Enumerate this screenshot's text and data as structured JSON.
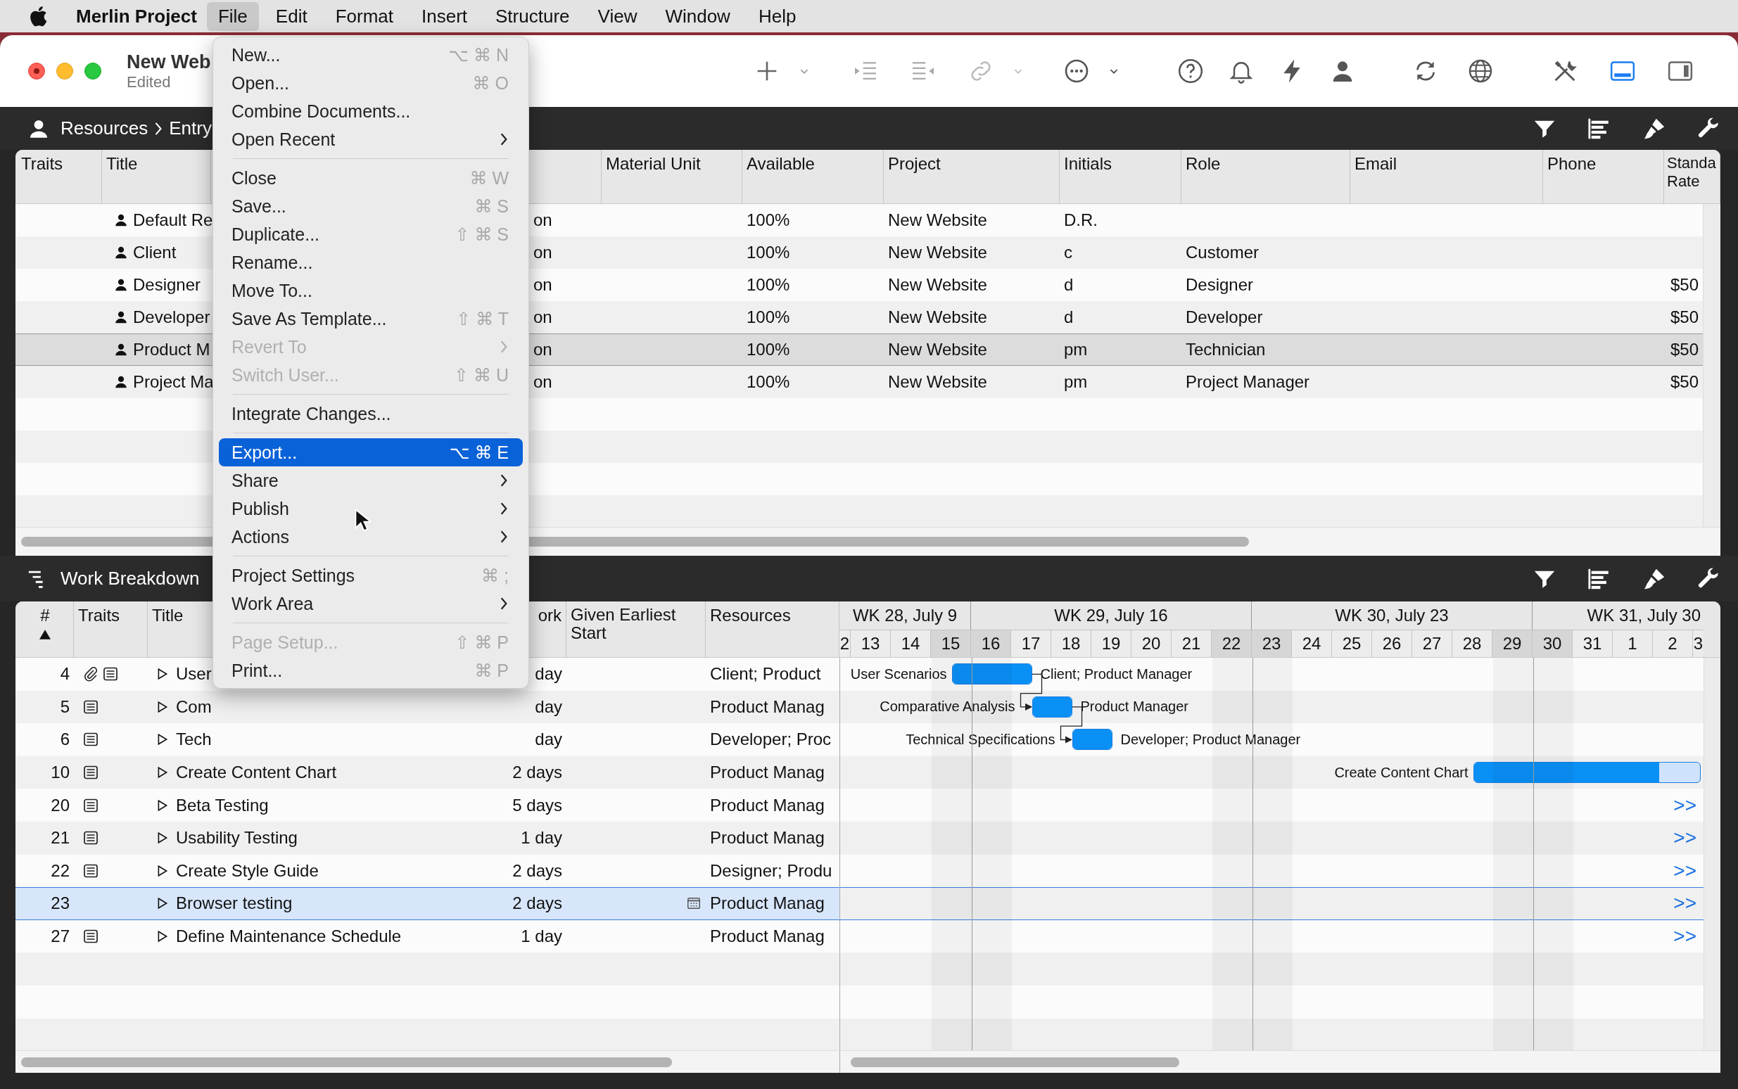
{
  "menu_bar": {
    "app_name": "Merlin Project",
    "menus": [
      {
        "label": "File",
        "selected": true
      },
      {
        "label": "Edit",
        "selected": false
      },
      {
        "label": "Format",
        "selected": false
      },
      {
        "label": "Insert",
        "selected": false
      },
      {
        "label": "Structure",
        "selected": false
      },
      {
        "label": "View",
        "selected": false
      },
      {
        "label": "Window",
        "selected": false
      },
      {
        "label": "Help",
        "selected": false
      }
    ]
  },
  "window": {
    "title": "New Web",
    "subtitle": "Edited"
  },
  "toolbar": {
    "layout_buttons": [
      {
        "selected": true
      },
      {
        "selected": false
      }
    ]
  },
  "resources_view": {
    "breadcrumb": [
      "Resources",
      "Entry"
    ],
    "headers": {
      "traits": "Traits",
      "title": "Title",
      "material_unit": "Material Unit",
      "available": "Available",
      "project": "Project",
      "initials": "Initials",
      "role": "Role",
      "email": "Email",
      "phone": "Phone",
      "standard_rate": "Standa Rate"
    },
    "rows": [
      {
        "title": "Default Re",
        "column_3": "on",
        "available": "100%",
        "project": "New Website",
        "initials": "D.R.",
        "selected": false
      },
      {
        "title": "Client",
        "column_3": "on",
        "available": "100%",
        "project": "New Website",
        "initials": "c",
        "role": "Customer",
        "selected": false
      },
      {
        "title": "Designer",
        "column_3": "on",
        "available": "100%",
        "project": "New Website",
        "initials": "d",
        "role": "Designer",
        "standard_rate": "$50",
        "selected": false
      },
      {
        "title": "Developer",
        "column_3": "on",
        "available": "100%",
        "project": "New Website",
        "initials": "d",
        "role": "Developer",
        "standard_rate": "$50",
        "selected": false
      },
      {
        "title": "Product M",
        "column_3": "on",
        "available": "100%",
        "project": "New Website",
        "initials": "pm",
        "role": "Technician",
        "standard_rate": "$50",
        "selected": true
      },
      {
        "title": "Project Ma",
        "column_3": "on",
        "available": "100%",
        "project": "New Website",
        "initials": "pm",
        "role": "Project Manager",
        "standard_rate": "$50",
        "selected": false
      }
    ]
  },
  "file_menu": {
    "items": [
      {
        "kind": "item",
        "label": "New...",
        "shortcut": "⌥ ⌘ N",
        "submenu": false,
        "disabled": false,
        "selected": false
      },
      {
        "kind": "item",
        "label": "Open...",
        "shortcut": "⌘ O",
        "submenu": false,
        "disabled": false,
        "selected": false
      },
      {
        "kind": "item",
        "label": "Combine Documents...",
        "submenu": false,
        "disabled": false,
        "selected": false
      },
      {
        "kind": "item",
        "label": "Open Recent",
        "submenu": true,
        "disabled": false,
        "selected": false
      },
      {
        "kind": "separator"
      },
      {
        "kind": "item",
        "label": "Close",
        "shortcut": "⌘ W",
        "submenu": false,
        "disabled": false,
        "selected": false
      },
      {
        "kind": "item",
        "label": "Save...",
        "shortcut": "⌘ S",
        "submenu": false,
        "disabled": false,
        "selected": false
      },
      {
        "kind": "item",
        "label": "Duplicate...",
        "shortcut": "⇧ ⌘ S",
        "submenu": false,
        "disabled": false,
        "selected": false
      },
      {
        "kind": "item",
        "label": "Rename...",
        "submenu": false,
        "disabled": false,
        "selected": false
      },
      {
        "kind": "item",
        "label": "Move To...",
        "submenu": false,
        "disabled": false,
        "selected": false
      },
      {
        "kind": "item",
        "label": "Save As Template...",
        "shortcut": "⇧ ⌘ T",
        "submenu": false,
        "disabled": false,
        "selected": false
      },
      {
        "kind": "item",
        "label": "Revert To",
        "submenu": true,
        "disabled": true,
        "selected": false
      },
      {
        "kind": "item",
        "label": "Switch User...",
        "shortcut": "⇧ ⌘ U",
        "submenu": false,
        "disabled": true,
        "selected": false
      },
      {
        "kind": "separator"
      },
      {
        "kind": "item",
        "label": "Integrate Changes...",
        "submenu": false,
        "disabled": false,
        "selected": false
      },
      {
        "kind": "separator"
      },
      {
        "kind": "item",
        "label": "Export...",
        "shortcut": "⌥ ⌘ E",
        "submenu": false,
        "disabled": false,
        "selected": true
      },
      {
        "kind": "item",
        "label": "Share",
        "submenu": true,
        "disabled": false,
        "selected": false
      },
      {
        "kind": "item",
        "label": "Publish",
        "submenu": true,
        "disabled": false,
        "selected": false
      },
      {
        "kind": "item",
        "label": "Actions",
        "submenu": true,
        "disabled": false,
        "selected": false
      },
      {
        "kind": "separator"
      },
      {
        "kind": "item",
        "label": "Project Settings",
        "shortcut": "⌘ ;",
        "submenu": false,
        "disabled": false,
        "selected": false
      },
      {
        "kind": "item",
        "label": "Work Area",
        "submenu": true,
        "disabled": false,
        "selected": false
      },
      {
        "kind": "separator"
      },
      {
        "kind": "item",
        "label": "Page Setup...",
        "shortcut": "⇧ ⌘ P",
        "submenu": false,
        "disabled": true,
        "selected": false
      },
      {
        "kind": "item",
        "label": "Print...",
        "shortcut": "⌘ P",
        "submenu": false,
        "disabled": false,
        "selected": false
      }
    ]
  },
  "work_view": {
    "title": "Work Breakdown",
    "headers": {
      "number": "#",
      "traits": "Traits",
      "title": "Title",
      "work": "ork",
      "start": "Given Earliest Start",
      "resources": "Resources"
    },
    "rows": [
      {
        "number": "4",
        "traits": [
          {
            "kind": "attachment"
          },
          {
            "kind": "note"
          }
        ],
        "expanded": false,
        "title": "User",
        "work": "day",
        "resources": "Client; Product",
        "selected": false,
        "gantt": {
          "kind": "bar",
          "label": "User Scenarios",
          "assignees": "Client; Product Manager",
          "level": 1,
          "linked": true
        }
      },
      {
        "number": "5",
        "traits": [
          {
            "kind": "note"
          }
        ],
        "expanded": false,
        "title": "Com",
        "work": "day",
        "resources": "Product Manag",
        "selected": false,
        "gantt": {
          "kind": "bar",
          "label": "Comparative Analysis",
          "assignees": "Product Manager",
          "level": 1,
          "linked": true
        }
      },
      {
        "number": "6",
        "traits": [
          {
            "kind": "note"
          }
        ],
        "expanded": false,
        "title": "Tech",
        "work": "day",
        "resources": "Developer; Proc",
        "selected": false,
        "gantt": {
          "kind": "bar",
          "label": "Technical Specifications",
          "assignees": "Developer; Product Manager",
          "level": 1,
          "linked": false
        }
      },
      {
        "number": "10",
        "traits": [
          {
            "kind": "note"
          }
        ],
        "expanded": false,
        "title": "Create Content Chart",
        "work": "2 days",
        "resources": "Product Manag",
        "selected": false,
        "gantt": {
          "kind": "bar",
          "label": "Create Content Chart",
          "level": 0.82,
          "linked": false
        }
      },
      {
        "number": "20",
        "traits": [
          {
            "kind": "note"
          }
        ],
        "expanded": false,
        "title": "Beta Testing",
        "work": "5 days",
        "resources": "Product Manag",
        "selected": false,
        "gantt": {
          "kind": "more",
          "label": ">>"
        }
      },
      {
        "number": "21",
        "traits": [
          {
            "kind": "note"
          }
        ],
        "expanded": false,
        "title": "Usability Testing",
        "work": "1 day",
        "resources": "Product Manag",
        "selected": false,
        "gantt": {
          "kind": "more",
          "label": ">>"
        }
      },
      {
        "number": "22",
        "traits": [
          {
            "kind": "note"
          }
        ],
        "expanded": false,
        "title": "Create Style Guide",
        "work": "2 days",
        "resources": "Designer; Produ",
        "selected": false,
        "gantt": {
          "kind": "more",
          "label": ">>"
        }
      },
      {
        "number": "23",
        "expanded": false,
        "title": "Browser testing",
        "work": "2 days",
        "start_constraint": true,
        "resources": "Product Manag",
        "selected": true,
        "gantt": {
          "kind": "more",
          "label": ">>"
        }
      },
      {
        "number": "27",
        "traits": [
          {
            "kind": "note"
          }
        ],
        "expanded": false,
        "title": "Define Maintenance Schedule",
        "work": "1 day",
        "resources": "Product Manag",
        "selected": false,
        "gantt": {
          "kind": "more",
          "label": ">>"
        }
      }
    ],
    "gantt": {
      "weeks": [
        {
          "label": "WK 28, July 9",
          "days": [
            {
              "label": "2",
              "kind": "partial",
              "shaded": false
            },
            {
              "label": "13",
              "kind": "full",
              "shaded": false
            },
            {
              "label": "14",
              "kind": "full",
              "shaded": false
            },
            {
              "label": "15",
              "kind": "full",
              "shaded": true
            }
          ]
        },
        {
          "label": "WK 29, July 16",
          "days": [
            {
              "label": "16",
              "kind": "full",
              "shaded": true
            },
            {
              "label": "17",
              "kind": "full",
              "shaded": false
            },
            {
              "label": "18",
              "kind": "full",
              "shaded": false
            },
            {
              "label": "19",
              "kind": "full",
              "shaded": false
            },
            {
              "label": "20",
              "kind": "full",
              "shaded": false
            },
            {
              "label": "21",
              "kind": "full",
              "shaded": false
            },
            {
              "label": "22",
              "kind": "full",
              "shaded": true
            }
          ]
        },
        {
          "label": "WK 30, July 23",
          "days": [
            {
              "label": "23",
              "kind": "full",
              "shaded": true
            },
            {
              "label": "24",
              "kind": "full",
              "shaded": false
            },
            {
              "label": "25",
              "kind": "full",
              "shaded": false
            },
            {
              "label": "26",
              "kind": "full",
              "shaded": false
            },
            {
              "label": "27",
              "kind": "full",
              "shaded": false
            },
            {
              "label": "28",
              "kind": "full",
              "shaded": false
            },
            {
              "label": "29",
              "kind": "full",
              "shaded": true
            }
          ]
        },
        {
          "label": "WK 31, July 30",
          "days": [
            {
              "label": "30",
              "kind": "full",
              "shaded": true
            },
            {
              "label": "31",
              "kind": "full",
              "shaded": false
            },
            {
              "label": "1",
              "kind": "full",
              "shaded": false
            },
            {
              "label": "2",
              "kind": "full",
              "shaded": false
            },
            {
              "label": "3",
              "kind": "partial",
              "shaded": false
            }
          ]
        }
      ]
    }
  }
}
